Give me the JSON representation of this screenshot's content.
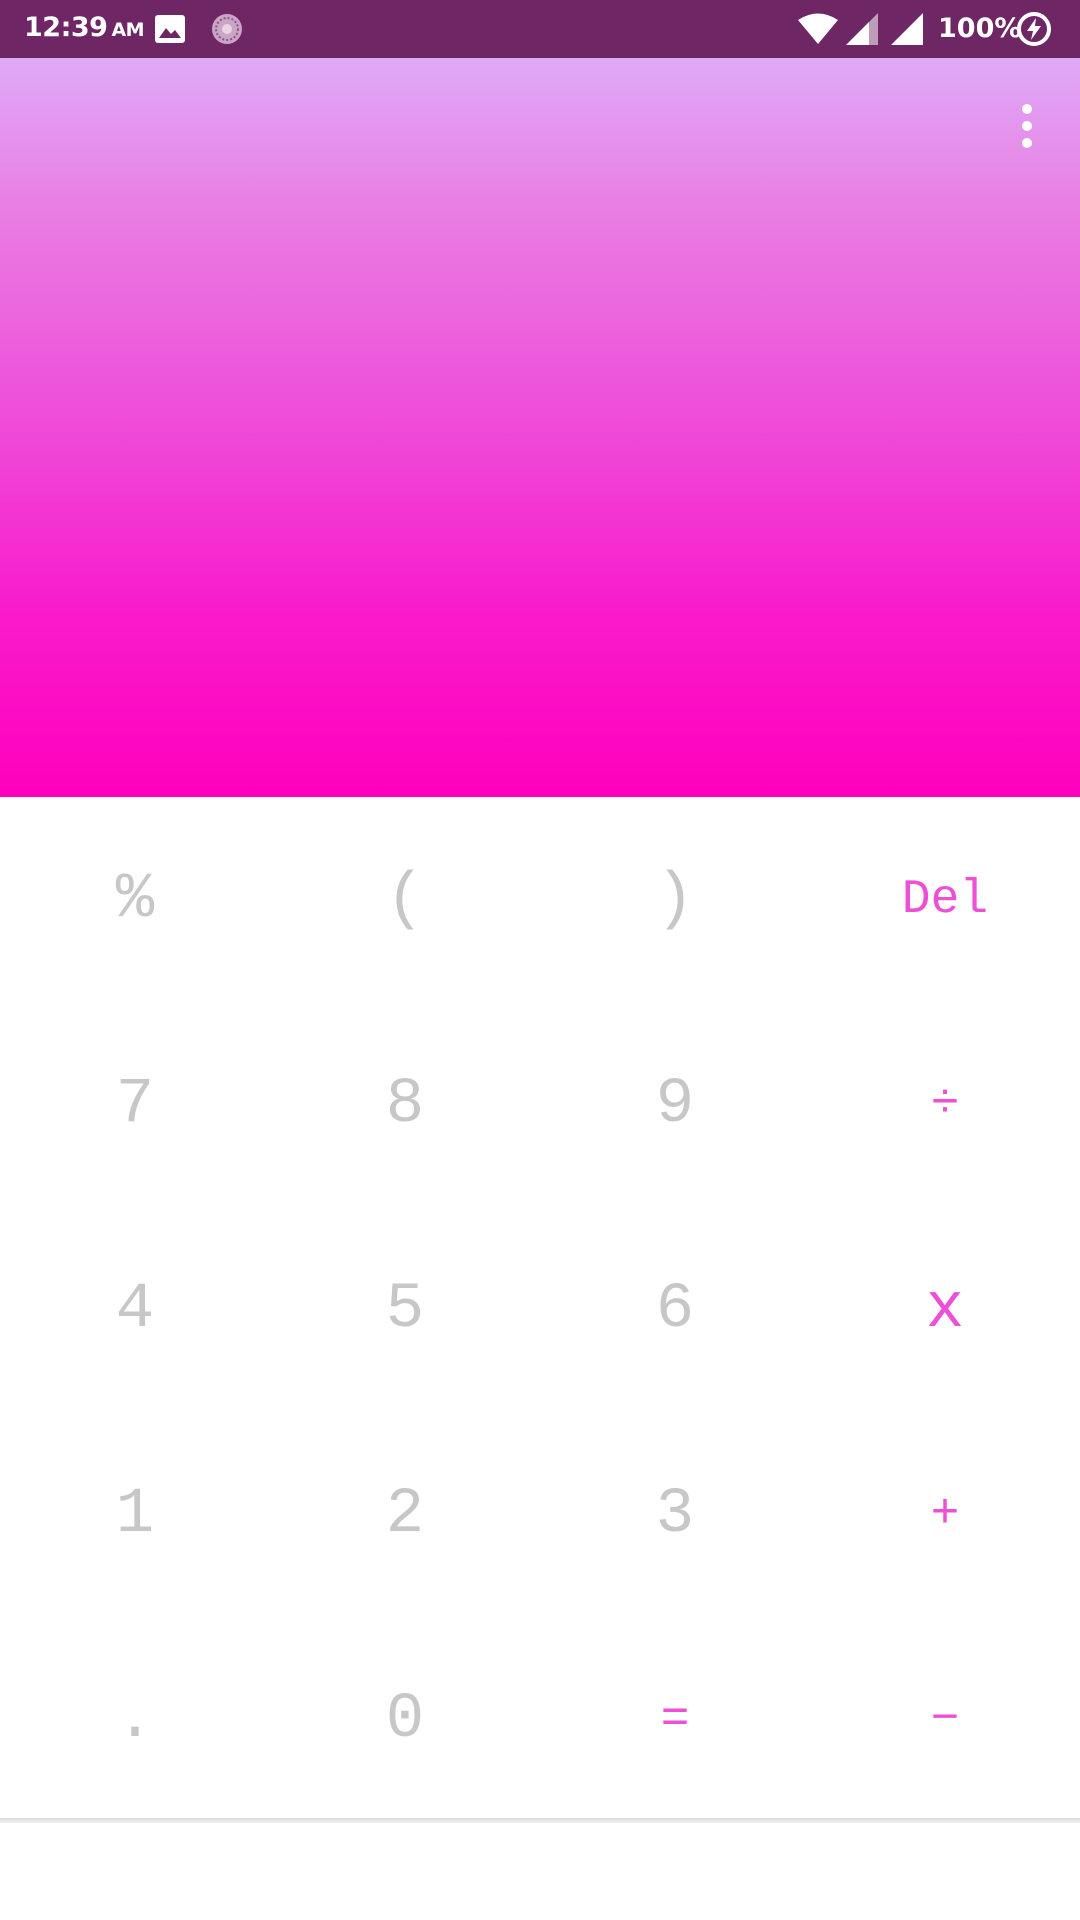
{
  "status_bar": {
    "time": "12:39",
    "ampm": "AM",
    "battery": "100%",
    "icons": [
      "image-icon",
      "sync-icon",
      "wifi-icon",
      "signal-icon",
      "signal-icon",
      "battery-charging-icon"
    ]
  },
  "display": {
    "gradient_top": "#dfaaf7",
    "gradient_bottom": "#ff00bd"
  },
  "keys": {
    "percent": "%",
    "open_paren": "(",
    "close_paren": ")",
    "del": "Del",
    "seven": "7",
    "eight": "8",
    "nine": "9",
    "divide": "÷",
    "four": "4",
    "five": "5",
    "six": "6",
    "multiply": "x",
    "one": "1",
    "two": "2",
    "three": "3",
    "plus": "+",
    "dot": ".",
    "zero": "0",
    "equals": "=",
    "minus": "−"
  },
  "colors": {
    "status_bar": "#6e2764",
    "digit": "#c7c7c7",
    "operator": "#ee4fd7"
  }
}
